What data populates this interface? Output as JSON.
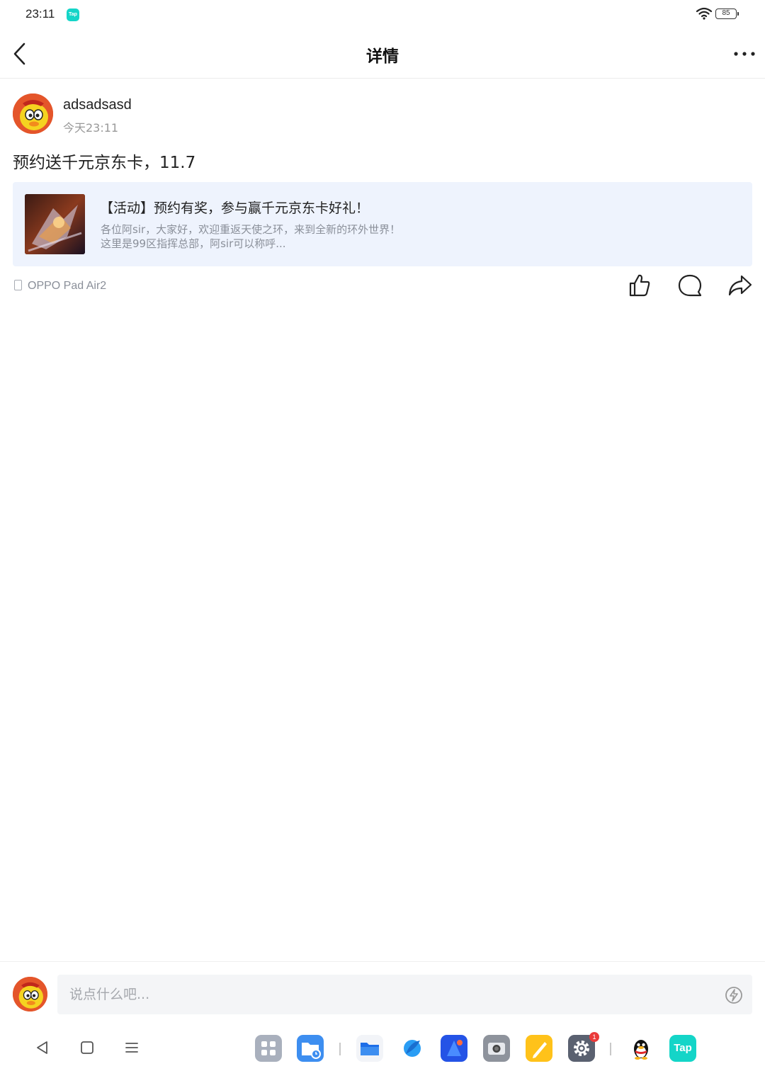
{
  "status_bar": {
    "time": "23:11",
    "app_badge": "Tap",
    "battery": "85"
  },
  "header": {
    "title": "详情"
  },
  "post": {
    "author_name": "adsadsasd",
    "time": "今天23:11",
    "text": "预约送千元京东卡，11.7",
    "card": {
      "title": "【活动】预约有奖，参与赢千元京东卡好礼！",
      "desc_line1": "各位阿sir，大家好，欢迎重返天使之环，来到全新的环外世界！",
      "desc_line2": "这里是99区指挥总部，阿sir可以称呼..."
    },
    "device": "OPPO Pad Air2"
  },
  "comment_bar": {
    "placeholder": "说点什么吧..."
  },
  "dock": {
    "tap_label": "Tap",
    "settings_badge": "1"
  },
  "colors": {
    "card_bg": "#eef3fd",
    "tap_brand": "#14d5c8",
    "avatar_bg": "#e4552a"
  }
}
